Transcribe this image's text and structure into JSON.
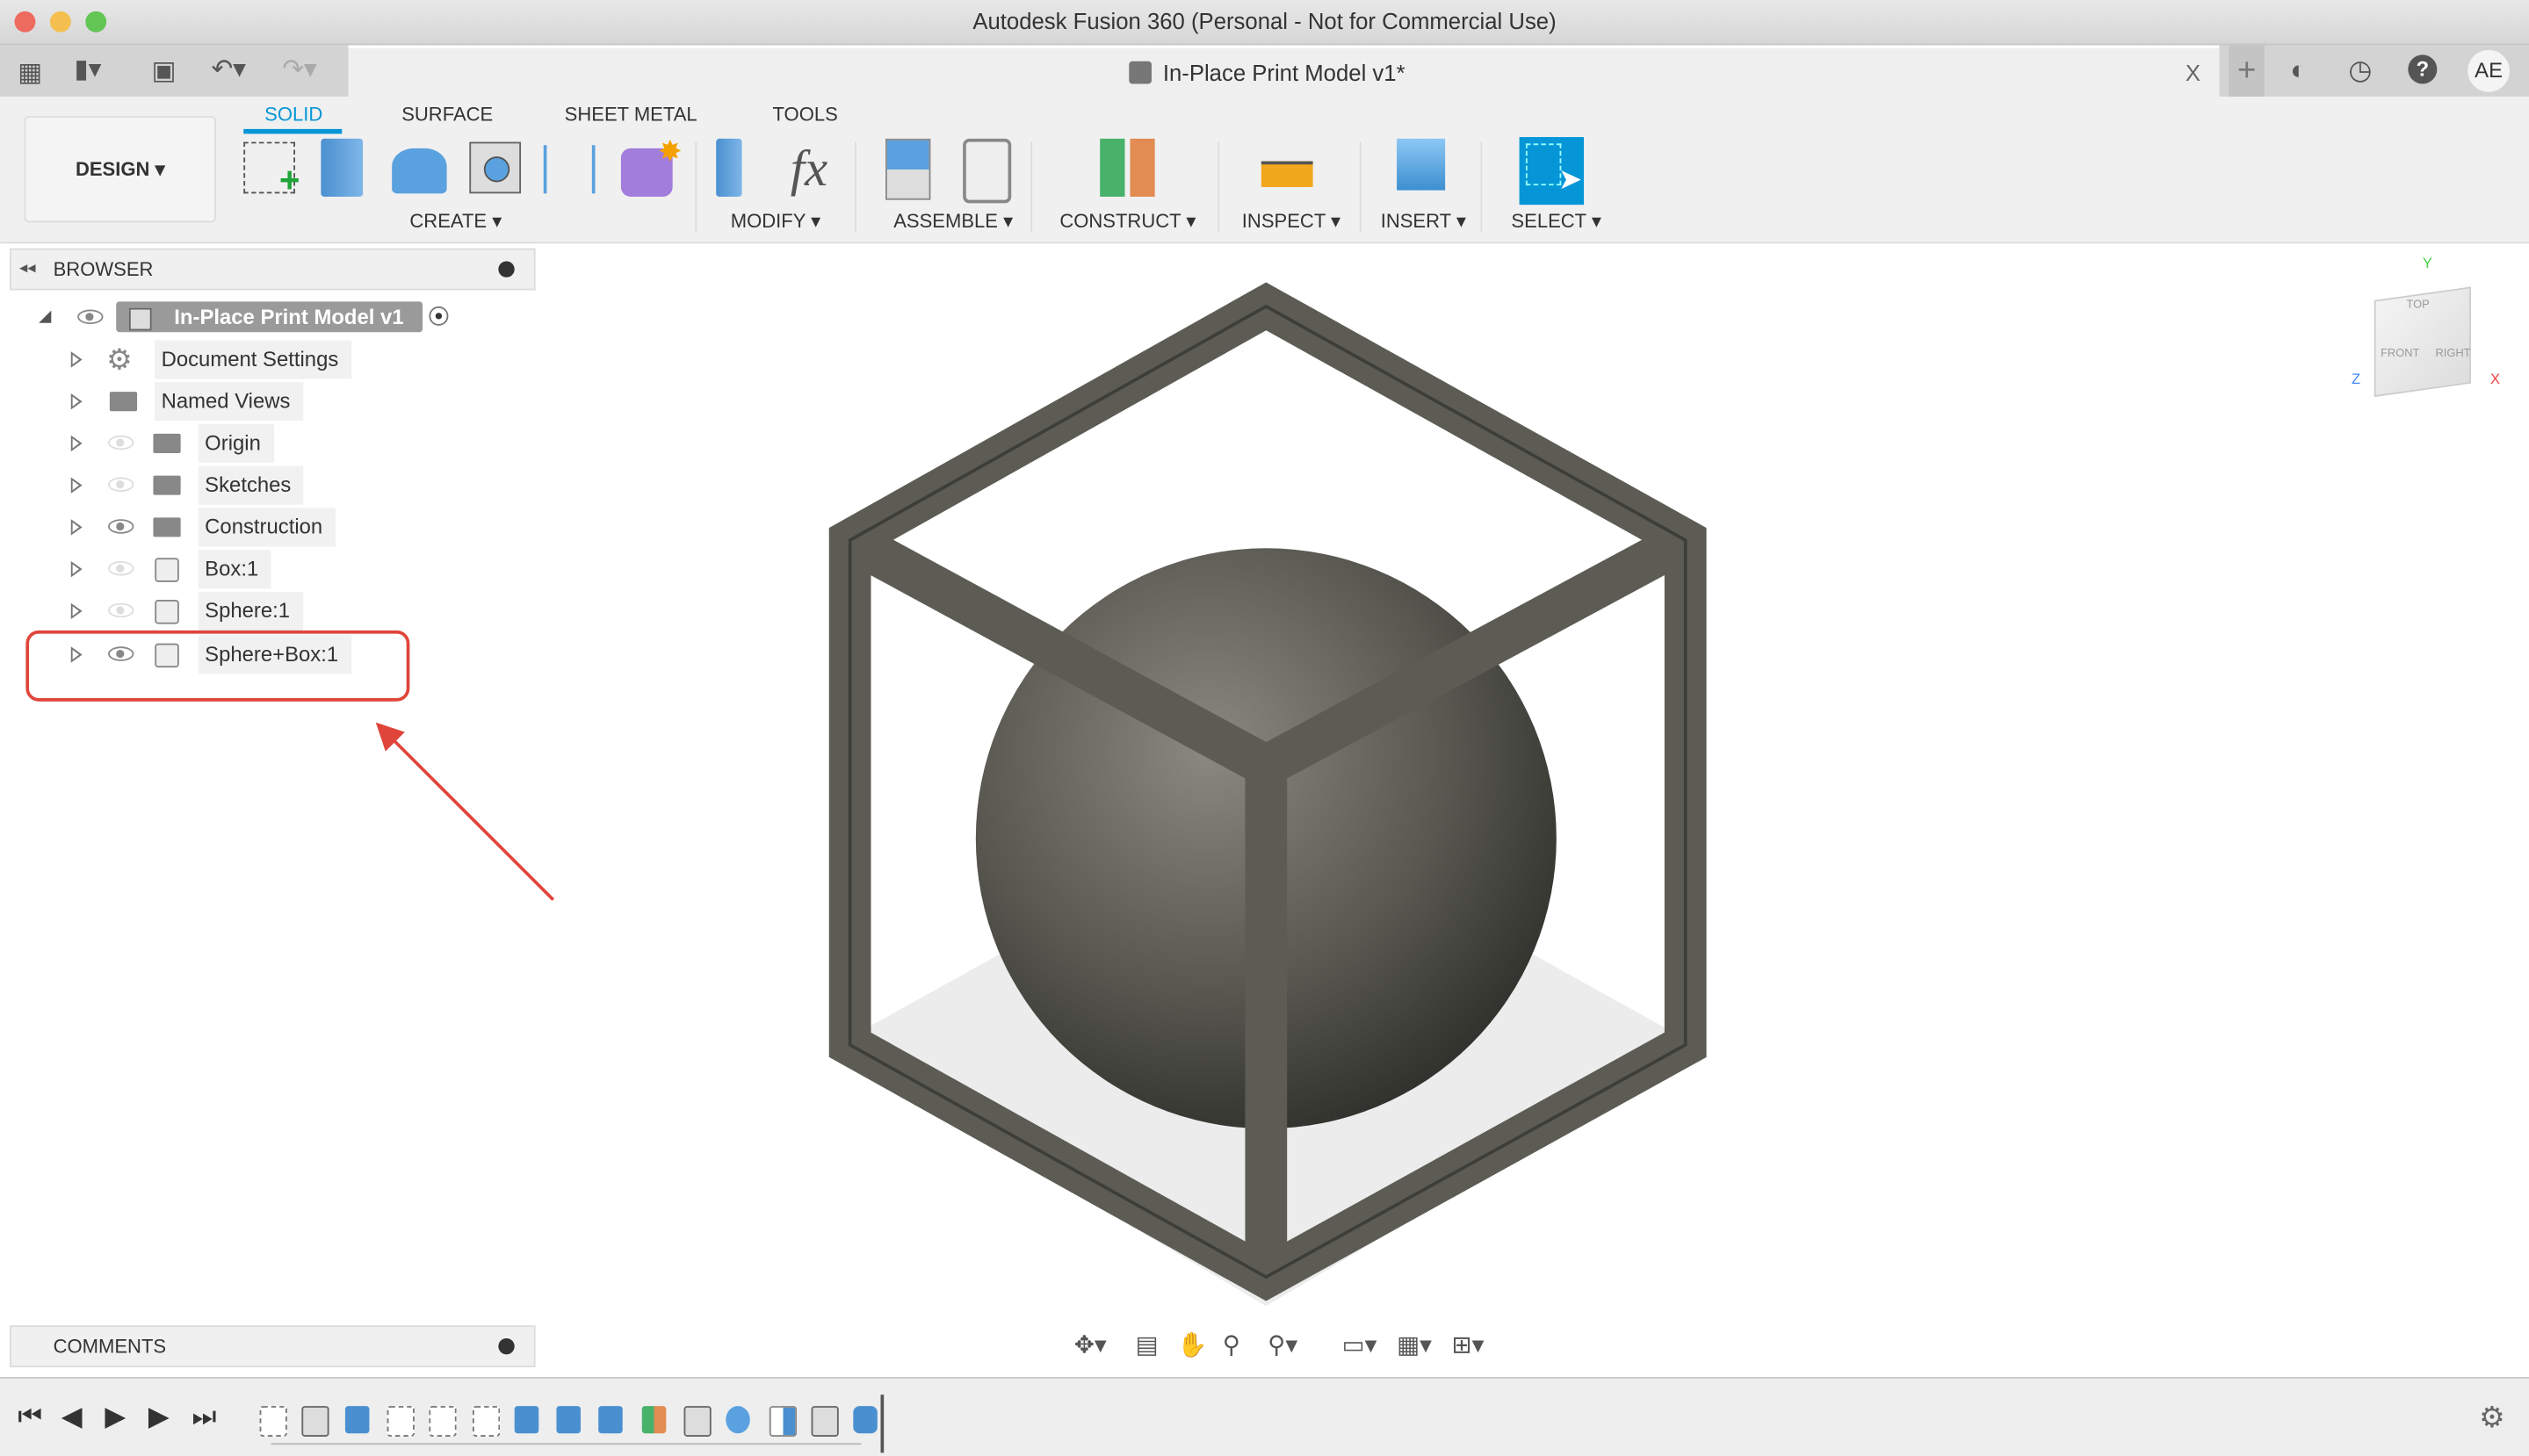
{
  "window": {
    "title": "Autodesk Fusion 360 (Personal - Not for Commercial Use)"
  },
  "document_tab": {
    "title": "In-Place Print Model v1*",
    "close": "X"
  },
  "user": {
    "initials": "AE"
  },
  "workspace": {
    "label": "DESIGN"
  },
  "ribbon_tabs": [
    {
      "label": "SOLID",
      "active": true
    },
    {
      "label": "SURFACE"
    },
    {
      "label": "SHEET METAL"
    },
    {
      "label": "TOOLS"
    }
  ],
  "ribbon_groups": [
    "CREATE",
    "MODIFY",
    "ASSEMBLE",
    "CONSTRUCT",
    "INSPECT",
    "INSERT",
    "SELECT"
  ],
  "browser": {
    "title": "BROWSER",
    "root": "In-Place Print Model v1",
    "items": [
      {
        "label": "Document Settings",
        "icon": "gear-icon",
        "visible": null
      },
      {
        "label": "Named Views",
        "icon": "folder-icon",
        "visible": null
      },
      {
        "label": "Origin",
        "icon": "folder-icon",
        "visible": false
      },
      {
        "label": "Sketches",
        "icon": "folder-icon",
        "visible": false
      },
      {
        "label": "Construction",
        "icon": "folder-icon",
        "visible": true
      },
      {
        "label": "Box:1",
        "icon": "body-icon",
        "visible": false
      },
      {
        "label": "Sphere:1",
        "icon": "body-icon",
        "visible": false
      },
      {
        "label": "Sphere+Box:1",
        "icon": "body-icon",
        "visible": true,
        "highlighted": true
      }
    ]
  },
  "comments": {
    "title": "COMMENTS"
  },
  "viewcube": {
    "top": "TOP",
    "front": "FRONT",
    "right": "RIGHT",
    "x": "X",
    "y": "Y",
    "z": "Z"
  },
  "colors": {
    "accent": "#0696d7",
    "highlight": "#e0453a",
    "model": "#5a5a52"
  },
  "timeline": {
    "features": [
      "sketch",
      "box",
      "extrude",
      "sketch",
      "sketch",
      "sketch",
      "extrude",
      "extrude",
      "extrude",
      "plane",
      "box",
      "sphere",
      "split",
      "box",
      "combine"
    ]
  }
}
